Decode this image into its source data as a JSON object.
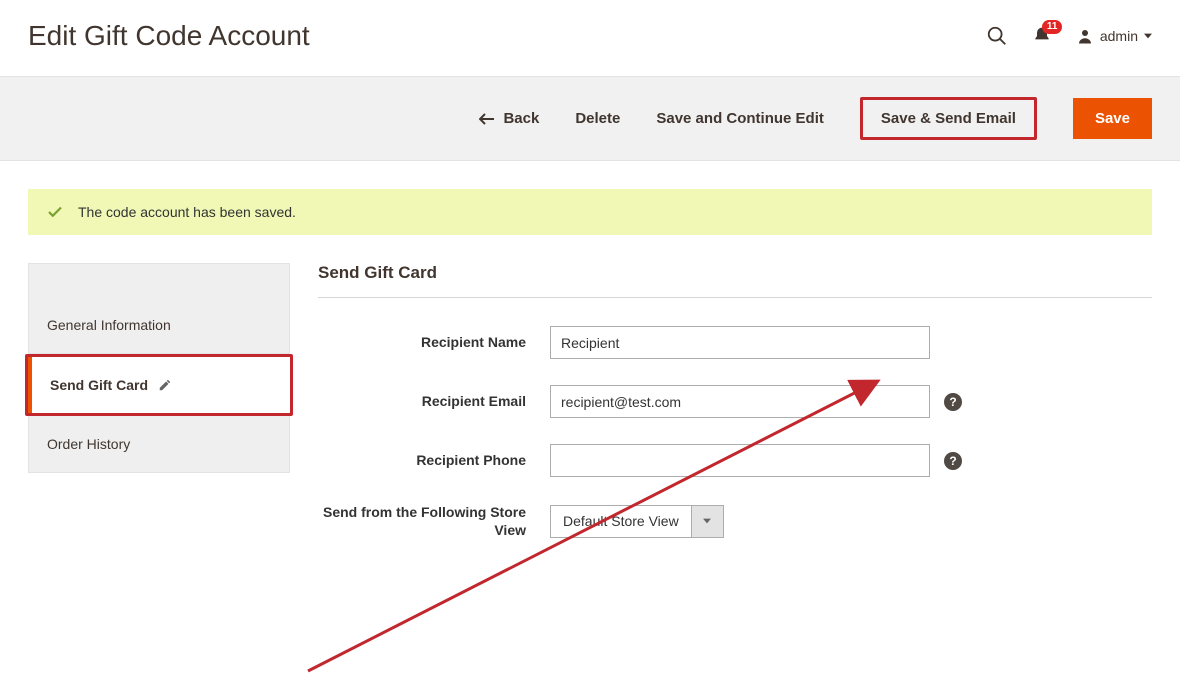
{
  "header": {
    "title": "Edit Gift Code Account",
    "notifications": "11",
    "user": "admin"
  },
  "actions": {
    "back": "Back",
    "delete": "Delete",
    "save_continue": "Save and Continue Edit",
    "save_send": "Save & Send Email",
    "save": "Save"
  },
  "message": "The code account has been saved.",
  "sidebar": {
    "items": {
      "general": "General Information",
      "send": "Send Gift Card",
      "history": "Order History"
    }
  },
  "form": {
    "section_title": "Send Gift Card",
    "fields": {
      "recipient_name": {
        "label": "Recipient Name",
        "value": "Recipient"
      },
      "recipient_email": {
        "label": "Recipient Email",
        "value": "recipient@test.com"
      },
      "recipient_phone": {
        "label": "Recipient Phone",
        "value": ""
      },
      "store_view": {
        "label": "Send from the Following Store View",
        "value": "Default Store View"
      }
    }
  }
}
